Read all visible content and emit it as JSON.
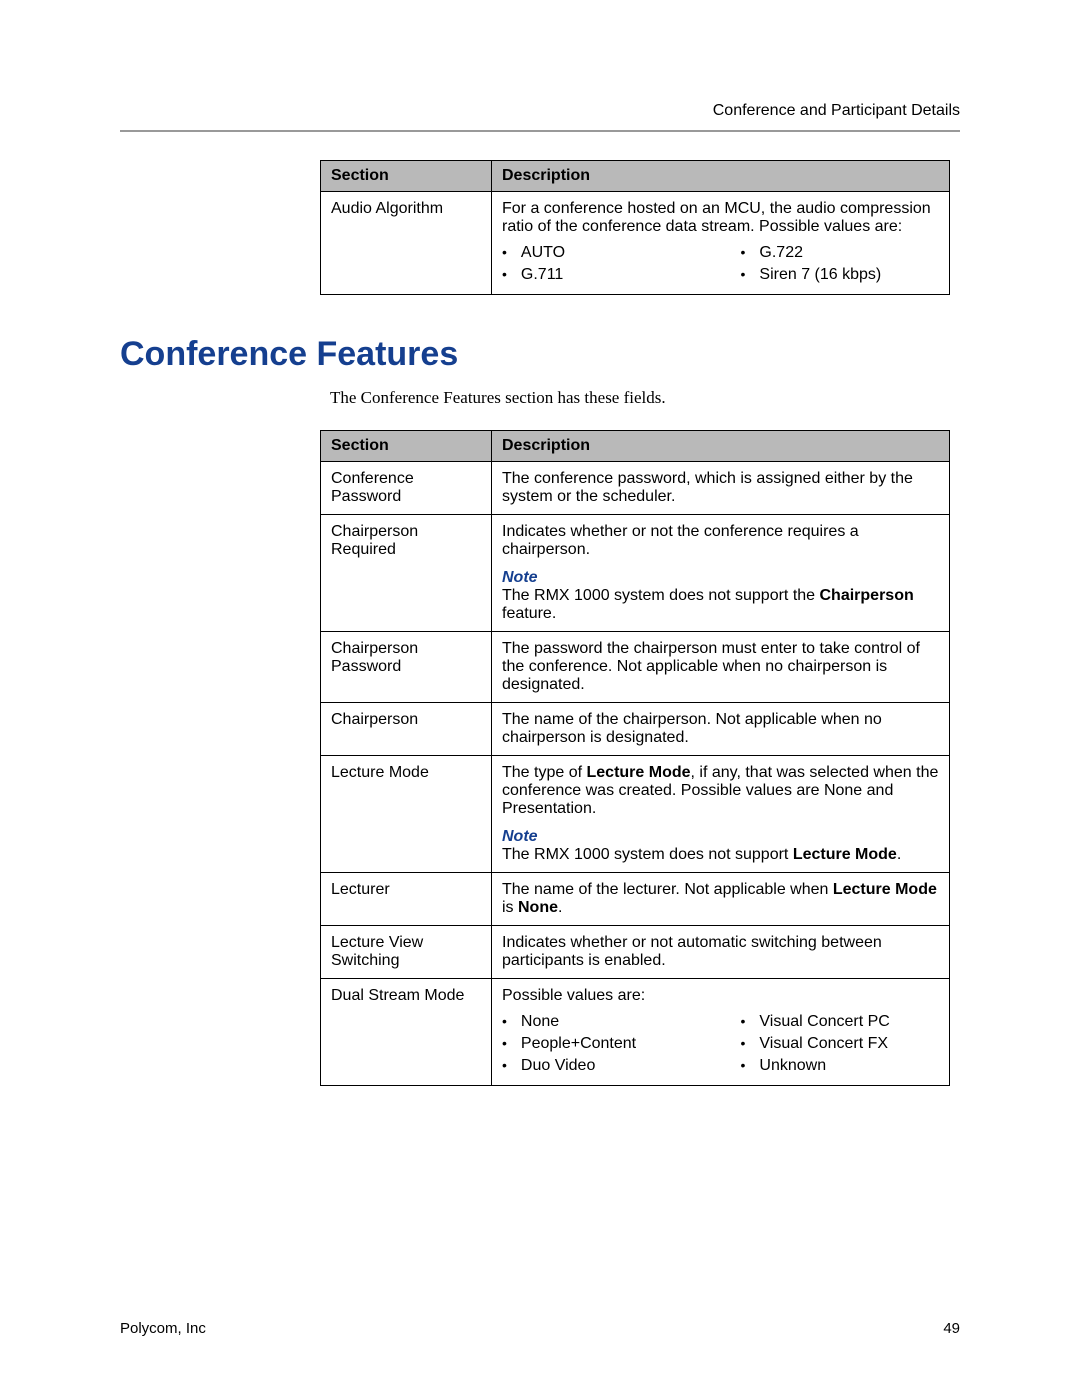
{
  "header": {
    "title": "Conference and Participant Details"
  },
  "table1": {
    "head_section": "Section",
    "head_desc": "Description",
    "row1_section": "Audio Algorithm",
    "row1_desc": "For a conference hosted on an MCU, the audio compression ratio of the conference data stream. Possible values are:",
    "row1_b1": "AUTO",
    "row1_b2": "G.711",
    "row1_b3": "G.722",
    "row1_b4": "Siren 7 (16 kbps)"
  },
  "heading": "Conference Features",
  "intro": "The Conference Features section has these fields.",
  "table2": {
    "head_section": "Section",
    "head_desc": "Description",
    "r1_s": "Conference Password",
    "r1_d": "The conference password, which is assigned either by the system or the scheduler.",
    "r2_s": "Chairperson Required",
    "r2_d": "Indicates whether or not the conference requires a chairperson.",
    "r2_note": "Note",
    "r2_note_t1": "The RMX 1000 system does not support the ",
    "r2_note_b": "Chairperson",
    "r2_note_t2": " feature.",
    "r3_s": "Chairperson Password",
    "r3_d": "The password the chairperson must enter to take control of the conference. Not applicable when no chairperson is designated.",
    "r4_s": "Chairperson",
    "r4_d": "The name of the chairperson. Not applicable when no chairperson is designated.",
    "r5_s": "Lecture Mode",
    "r5_d1": "The type of ",
    "r5_b1": "Lecture Mode",
    "r5_d2": ", if any, that was selected when the conference was created. Possible values are None and Presentation.",
    "r5_note": "Note",
    "r5_note_t1": "The RMX 1000 system does not support ",
    "r5_note_b": "Lecture Mode",
    "r5_note_t2": ".",
    "r6_s": "Lecturer",
    "r6_d1": "The name of the lecturer. Not applicable when ",
    "r6_b1": "Lecture Mode",
    "r6_d2": " is ",
    "r6_b2": "None",
    "r6_d3": ".",
    "r7_s": "Lecture View Switching",
    "r7_d": "Indicates whether or not automatic switching between participants is enabled.",
    "r8_s": "Dual Stream Mode",
    "r8_d": "Possible values are:",
    "r8_b1": "None",
    "r8_b2": "People+Content",
    "r8_b3": "Duo Video",
    "r8_b4": "Visual Concert PC",
    "r8_b5": "Visual Concert FX",
    "r8_b6": "Unknown"
  },
  "footer": {
    "left": "Polycom, Inc",
    "right": "49"
  }
}
